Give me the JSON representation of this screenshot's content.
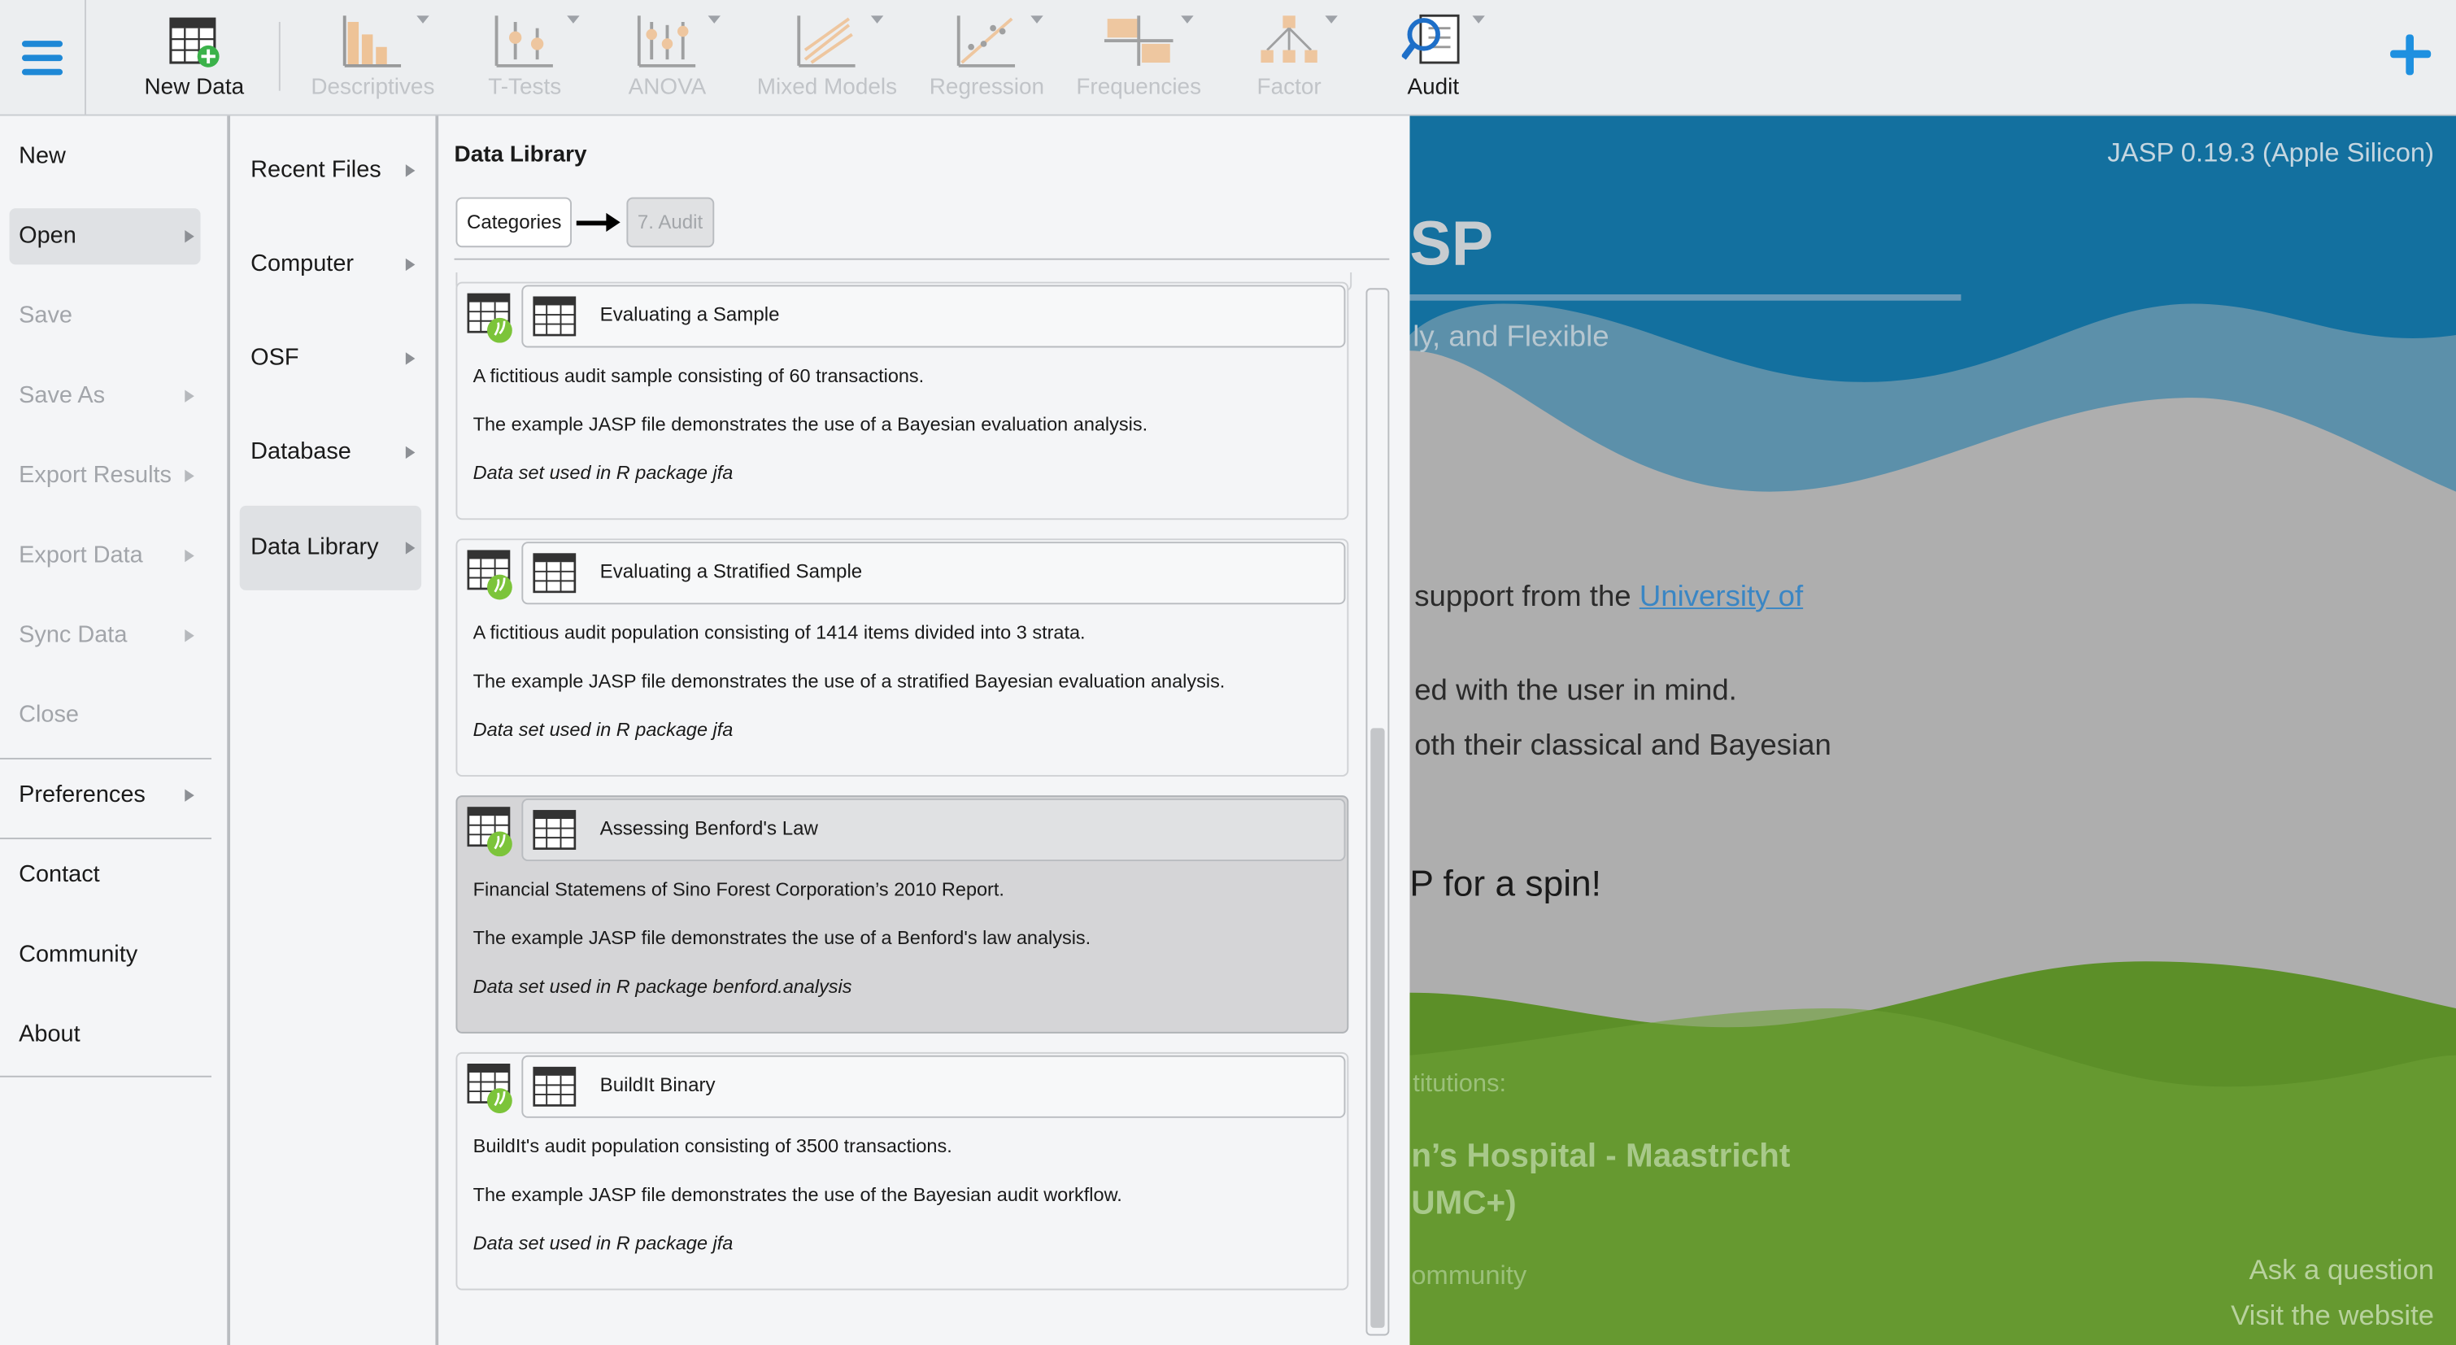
{
  "toolbar": {
    "new_data": "New Data",
    "tools": [
      {
        "label": "Descriptives",
        "icon": "descriptives-icon",
        "enabled": false
      },
      {
        "label": "T-Tests",
        "icon": "t-tests-icon",
        "enabled": false
      },
      {
        "label": "ANOVA",
        "icon": "anova-icon",
        "enabled": false
      },
      {
        "label": "Mixed Models",
        "icon": "mixed-models-icon",
        "enabled": false
      },
      {
        "label": "Regression",
        "icon": "regression-icon",
        "enabled": false
      },
      {
        "label": "Frequencies",
        "icon": "frequencies-icon",
        "enabled": false
      },
      {
        "label": "Factor",
        "icon": "factor-icon",
        "enabled": false
      },
      {
        "label": "Audit",
        "icon": "audit-icon",
        "enabled": true
      }
    ]
  },
  "main_menu": {
    "items": [
      {
        "label": "New",
        "enabled": true,
        "submenu": false
      },
      {
        "label": "Open",
        "enabled": true,
        "submenu": true,
        "selected": true
      },
      {
        "label": "Save",
        "enabled": false,
        "submenu": false
      },
      {
        "label": "Save As",
        "enabled": false,
        "submenu": true
      },
      {
        "label": "Export Results",
        "enabled": false,
        "submenu": true
      },
      {
        "label": "Export Data",
        "enabled": false,
        "submenu": true
      },
      {
        "label": "Sync Data",
        "enabled": false,
        "submenu": true
      },
      {
        "label": "Close",
        "enabled": false,
        "submenu": false
      },
      {
        "label": "Preferences",
        "enabled": true,
        "submenu": true
      },
      {
        "label": "Contact",
        "enabled": true,
        "submenu": false
      },
      {
        "label": "Community",
        "enabled": true,
        "submenu": false
      },
      {
        "label": "About",
        "enabled": true,
        "submenu": false
      }
    ]
  },
  "open_menu": {
    "items": [
      {
        "label": "Recent Files"
      },
      {
        "label": "Computer"
      },
      {
        "label": "OSF"
      },
      {
        "label": "Database"
      },
      {
        "label": "Data Library",
        "selected": true
      }
    ]
  },
  "library": {
    "title": "Data Library",
    "breadcrumb": {
      "root": "Categories",
      "current": "7. Audit"
    },
    "datasets": [
      {
        "title": "Evaluating a Sample",
        "description": "A fictitious audit sample consisting of 60 transactions.",
        "example": "The example JASP file demonstrates the use of a Bayesian evaluation analysis.",
        "source": "Data set used in R package jfa"
      },
      {
        "title": "Evaluating a Stratified Sample",
        "description": "A fictitious audit population consisting of 1414 items divided into 3 strata.",
        "example": "The example JASP file demonstrates the use of a stratified Bayesian evaluation analysis.",
        "source": "Data set used in R package jfa"
      },
      {
        "title": "Assessing Benford's Law",
        "description": "Financial Statemens of Sino Forest Corporation’s 2010 Report.",
        "example": "The example JASP file demonstrates the use of a Benford's law analysis.",
        "source": "Data set used in R package benford.analysis",
        "highlighted": true
      },
      {
        "title": "BuildIt Binary",
        "description": "BuildIt's audit population consisting of 3500 transactions.",
        "example": "The example JASP file demonstrates the use of the Bayesian audit workflow.",
        "source": "Data set used in R package jfa"
      }
    ]
  },
  "welcome": {
    "version": "JASP 0.19.3 (Apple Silicon)",
    "title_fragment": "SP",
    "subtitle_fragment": "ly, and Flexible",
    "support_text": "support from the ",
    "support_link": "University of",
    "line_user": "ed with the user in mind.",
    "line_classical": "oth their classical and Bayesian",
    "spin": "P for a spin!",
    "institutions_label": "titutions:",
    "hospital_line1": "n’s Hospital - Maastricht",
    "hospital_line2": "UMC+)",
    "community": "ommunity",
    "ask": "Ask a question",
    "visit": "Visit the website"
  },
  "colors": {
    "accent": "#1e88d6",
    "welcome_blue": "#0d6796",
    "welcome_green": "#5c8f28",
    "link": "#3a86c4"
  }
}
